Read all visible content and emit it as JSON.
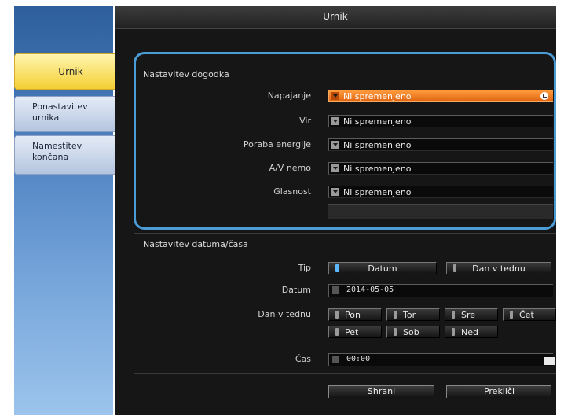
{
  "sidebar": {
    "items": [
      {
        "label": "Urnik"
      },
      {
        "label": "Ponastavitev\nurnika"
      },
      {
        "label": "Namestitev\nkončana"
      }
    ]
  },
  "window": {
    "title": "Urnik"
  },
  "event_section": {
    "title": "Nastavitev dogodka",
    "rows": [
      {
        "label": "Napajanje",
        "value": "Ni spremenjeno"
      },
      {
        "label": "Vir",
        "value": "Ni spremenjeno"
      },
      {
        "label": "Poraba energije",
        "value": "Ni spremenjeno"
      },
      {
        "label": "A/V nemo",
        "value": "Ni spremenjeno"
      },
      {
        "label": "Glasnost",
        "value": "Ni spremenjeno"
      }
    ]
  },
  "datetime_section": {
    "title": "Nastavitev datuma/časa",
    "type_label": "Tip",
    "type_options": [
      "Datum",
      "Dan v tednu"
    ],
    "selected_type": "Datum",
    "date_label": "Datum",
    "date_value": "2014-05-05",
    "weekday_label": "Dan v tednu",
    "weekdays": [
      "Pon",
      "Tor",
      "Sre",
      "Čet",
      "Pet",
      "Sob",
      "Ned"
    ],
    "time_label": "Čas",
    "time_value": "00:00"
  },
  "actions": {
    "save": "Shrani",
    "cancel": "Prekliči"
  },
  "colors": {
    "accent": "#ff8a2a",
    "highlight": "#4a9bd6",
    "sidebar": "#4f82c2"
  }
}
